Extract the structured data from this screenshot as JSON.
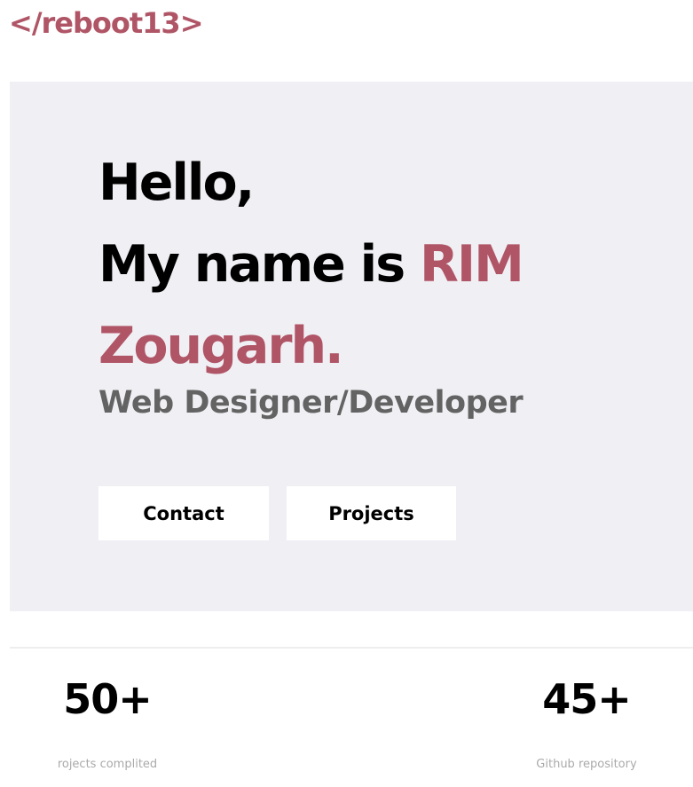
{
  "header": {
    "logo_text": "</reboot13>"
  },
  "hero": {
    "greeting": "Hello,",
    "intro_prefix": "My name is ",
    "name": "RIM Zougarh.",
    "subtitle": "Web Designer/Developer",
    "contact_label": "Contact",
    "projects_label": "Projects"
  },
  "stats": [
    {
      "value": "50+",
      "label": "rojects complited"
    },
    {
      "value": "45+",
      "label": "Github repository"
    }
  ],
  "colors": {
    "accent": "#b05566",
    "hero_background": "#f0eff4",
    "subtitle": "#636363",
    "stat_label": "#aaaaaa"
  }
}
